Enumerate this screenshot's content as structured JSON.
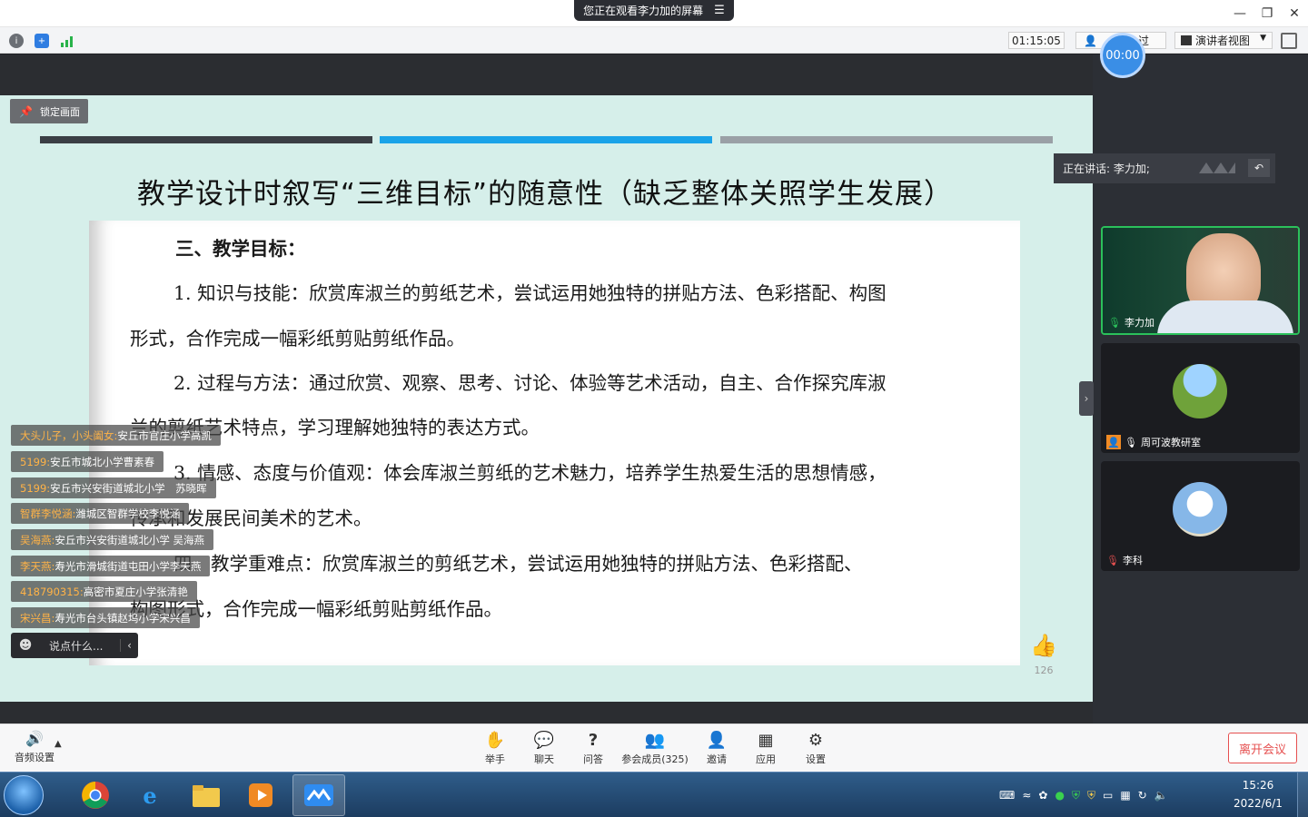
{
  "window": {
    "viewing_banner": "您正在观看李力加的屏幕",
    "minimize": "—",
    "restore": "❐",
    "close": "✕"
  },
  "toolbar": {
    "timer": "01:15:05",
    "member_label": "过",
    "view_label": "演讲者视图",
    "record_time": "00:00"
  },
  "share": {
    "lock_label": "锁定画面",
    "progress_colors": [
      "#3b3f45",
      "#1aa3e8",
      "#9aa0a6"
    ],
    "slide_title": "教学设计时叙写“三维目标”的随意性（缺乏整体关照学生发展）",
    "doc_lines": [
      "三、教学目标：",
      "1. 知识与技能：欣赏库淑兰的剪纸艺术，尝试运用她独特的拼贴方法、色彩搭配、构图",
      "形式，合作完成一幅彩纸剪贴剪纸作品。",
      "2. 过程与方法：通过欣赏、观察、思考、讨论、体验等艺术活动，自主、合作探究库淑",
      "兰的剪纸艺术特点，学习理解她独特的表达方式。",
      "3. 情感、态度与价值观：体会库淑兰剪纸的艺术魅力，培养学生热爱生活的思想情感，",
      "传承和发展民间美术的艺术。",
      "四、教学重难点：欣赏库淑兰的剪纸艺术，尝试运用她独特的拼贴方法、色彩搭配、",
      "构图形式，合作完成一幅彩纸剪贴剪纸作品。"
    ],
    "comments": [
      {
        "name": "大头儿子，小头阖女:",
        "text": "安丘市官庄小学高凯"
      },
      {
        "name": "5199:",
        "text": "安丘市城北小学曹素春"
      },
      {
        "name": "5199:",
        "text": "安丘市兴安街道城北小学　苏晓晖"
      },
      {
        "name": "智群李悦涵:",
        "text": "潍城区智群学校李悦涵"
      },
      {
        "name": "吴海燕:",
        "text": "安丘市兴安街道城北小学  吴海燕"
      },
      {
        "name": "李天燕:",
        "text": "寿光市滑城街道屯田小学李天燕"
      },
      {
        "name": "418790315:",
        "text": "高密市夏庄小学张清艳"
      },
      {
        "name": "宋兴昌:",
        "text": "寿光市台头镇赵坞小学宋兴昌"
      }
    ],
    "chat_placeholder": "说点什么...",
    "like_count": "126"
  },
  "right_panel": {
    "speaking_label": "正在讲话: 李力加;",
    "participants": [
      {
        "name": "李力加"
      },
      {
        "name": "周可波教研室"
      },
      {
        "name": "李科"
      }
    ]
  },
  "controls": {
    "audio_settings": "音频设置",
    "items": [
      {
        "label": "举手",
        "icon": "raise-hand-icon"
      },
      {
        "label": "聊天",
        "icon": "chat-icon"
      },
      {
        "label": "问答",
        "icon": "qa-icon"
      },
      {
        "label": "参会成员(325)",
        "icon": "members-icon"
      },
      {
        "label": "邀请",
        "icon": "invite-icon"
      },
      {
        "label": "应用",
        "icon": "apps-icon"
      },
      {
        "label": "设置",
        "icon": "settings-icon"
      }
    ],
    "leave": "离开会议"
  },
  "taskbar": {
    "time": "15:26",
    "date": "2022/6/1"
  }
}
